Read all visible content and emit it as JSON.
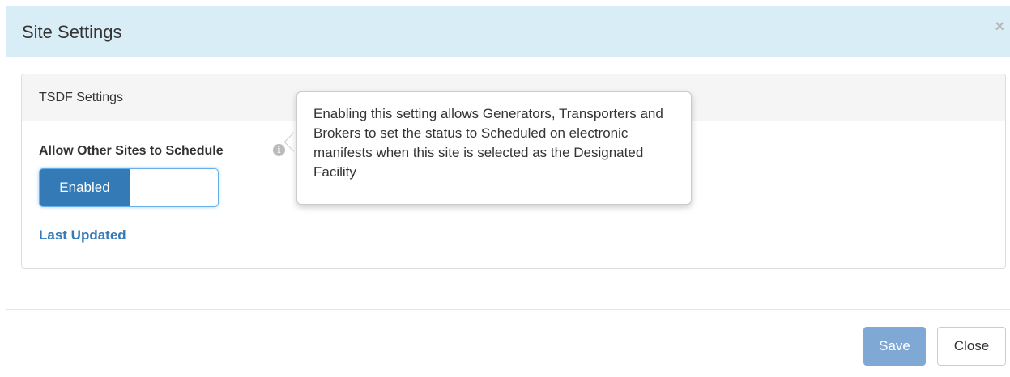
{
  "modal": {
    "title": "Site Settings",
    "close_glyph": "×"
  },
  "panel": {
    "heading": "TSDF Settings",
    "setting_label": "Allow Other Sites to Schedule",
    "info_glyph": "i",
    "toggle": {
      "on_label": "Enabled",
      "state": "enabled"
    },
    "last_updated_link": "Last Updated"
  },
  "tooltip": {
    "text": "Enabling this setting allows Generators, Transporters and Brokers to set the status to Scheduled on electronic manifests when this site is selected as the Designated Facility"
  },
  "footer": {
    "save_label": "Save",
    "close_label": "Close"
  },
  "colors": {
    "header_bg": "#d9edf7",
    "primary": "#337ab7",
    "save_disabled": "#7fa9d4"
  }
}
